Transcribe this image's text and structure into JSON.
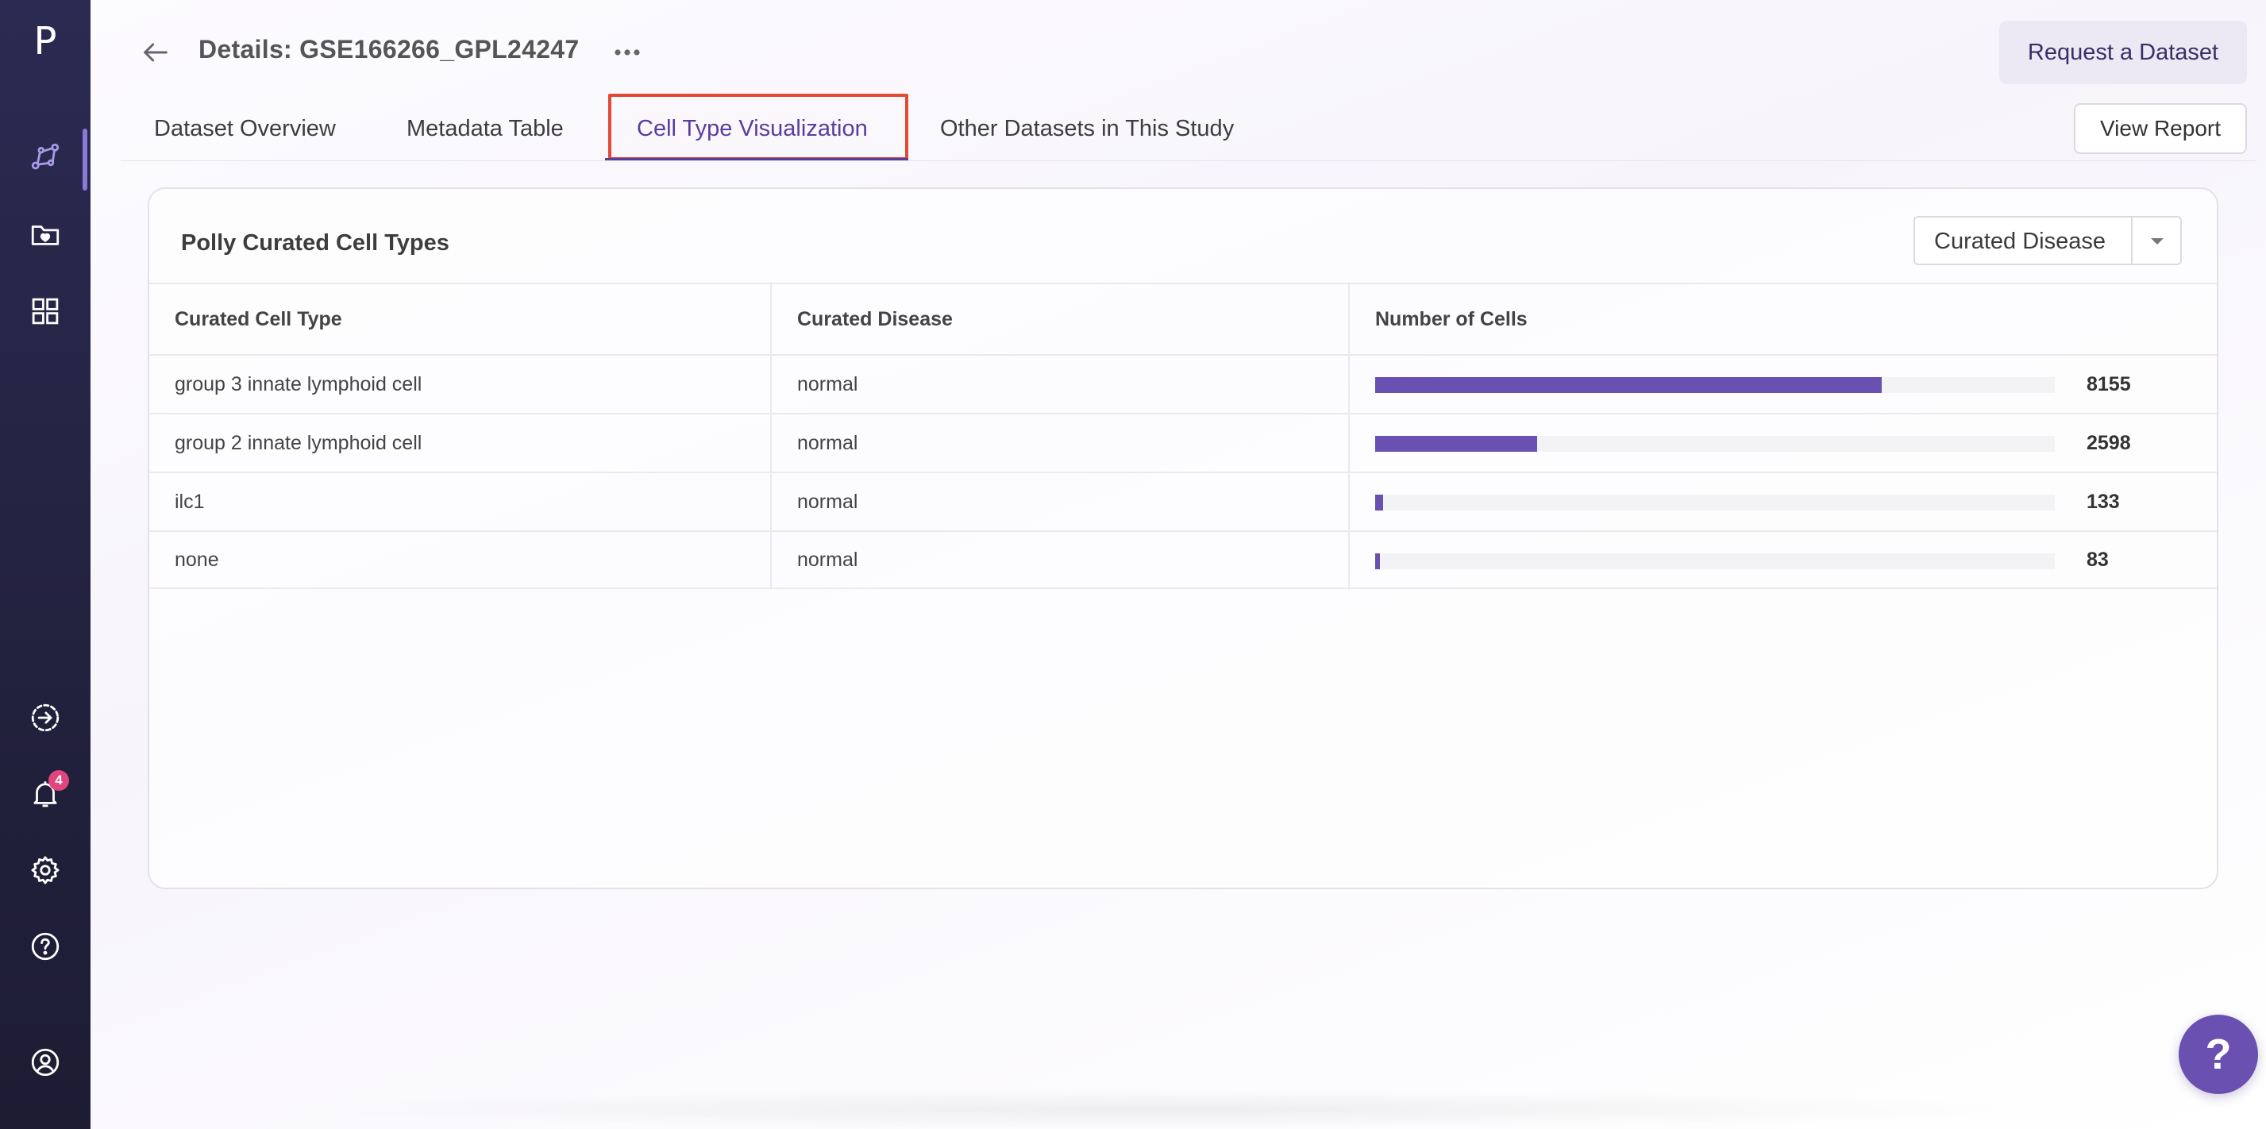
{
  "sidebar": {
    "logo": "P",
    "nav_items": [
      {
        "name": "analysis",
        "icon": "network-graph-icon",
        "active": true
      },
      {
        "name": "datasets",
        "icon": "folder-heart-icon"
      },
      {
        "name": "apps",
        "icon": "grid-icon"
      }
    ],
    "bottom_items": [
      {
        "name": "transfer",
        "icon": "circle-arrow-icon"
      },
      {
        "name": "notifications",
        "icon": "bell-icon",
        "badge": "4"
      },
      {
        "name": "settings",
        "icon": "gear-icon"
      },
      {
        "name": "help",
        "icon": "question-circle-icon"
      },
      {
        "name": "profile",
        "icon": "user-circle-icon"
      }
    ]
  },
  "header": {
    "title": "Details: GSE166266_GPL24247",
    "request_button": "Request a Dataset"
  },
  "tabs": [
    {
      "label": "Dataset Overview",
      "active": false
    },
    {
      "label": "Metadata Table",
      "active": false
    },
    {
      "label": "Cell Type Visualization",
      "active": true
    },
    {
      "label": "Other Datasets in This Study",
      "active": false
    }
  ],
  "view_report_button": "View Report",
  "card": {
    "title": "Polly Curated Cell Types",
    "group_by": {
      "selected": "Curated Disease"
    },
    "columns": [
      "Curated Cell Type",
      "Curated Disease",
      "Number of Cells"
    ],
    "rows": [
      {
        "cell_type": "group 3 innate lymphoid cell",
        "disease": "normal",
        "count": "8155",
        "fraction": 0.745
      },
      {
        "cell_type": "group 2 innate lymphoid cell",
        "disease": "normal",
        "count": "2598",
        "fraction": 0.238
      },
      {
        "cell_type": "ilc1",
        "disease": "normal",
        "count": "133",
        "fraction": 0.012
      },
      {
        "cell_type": "none",
        "disease": "normal",
        "count": "83",
        "fraction": 0.007
      }
    ]
  },
  "colors": {
    "accent": "#6a50b0",
    "active_tab": "#5a3c9e",
    "highlight_box": "#e24a33",
    "sidebar_bg": "#25243f",
    "badge": "#e0457b"
  },
  "help_fab": "?"
}
